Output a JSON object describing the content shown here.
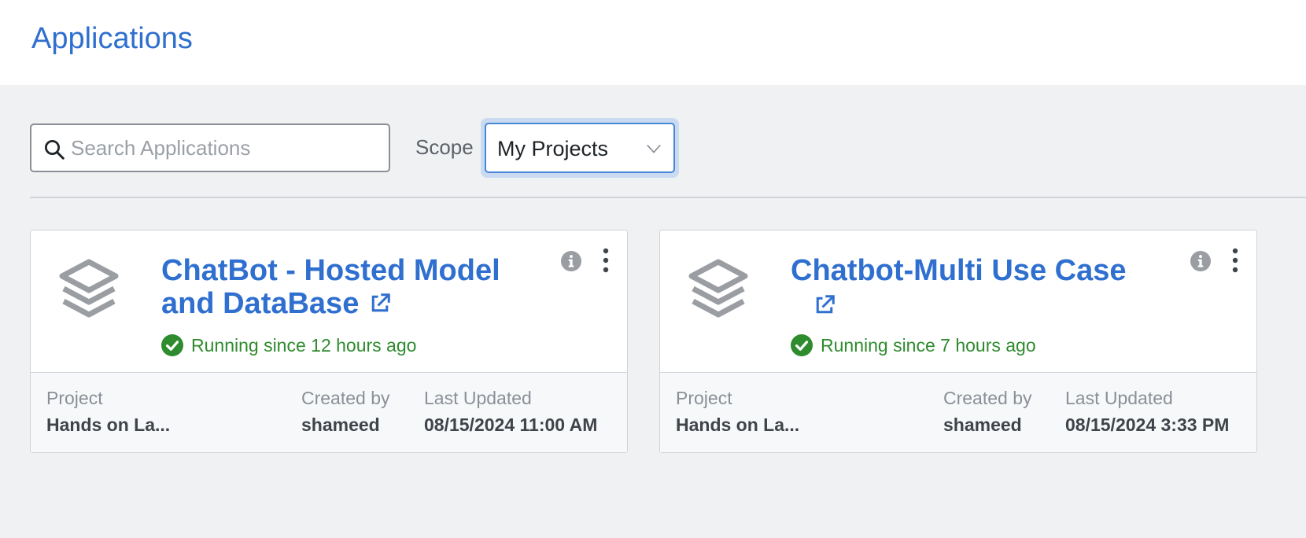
{
  "header": {
    "title": "Applications"
  },
  "toolbar": {
    "search_placeholder": "Search Applications",
    "search_value": "",
    "scope_label": "Scope",
    "scope_value": "My Projects"
  },
  "labels": {
    "project": "Project",
    "created_by": "Created by",
    "last_updated": "Last Updated"
  },
  "applications": [
    {
      "title": "ChatBot - Hosted Model and DataBase",
      "status": "Running since 12 hours ago",
      "project": "Hands on La...",
      "created_by": "shameed",
      "last_updated": "08/15/2024 11:00 AM"
    },
    {
      "title": "Chatbot-Multi Use Case",
      "status": "Running since 7 hours ago",
      "project": "Hands on La...",
      "created_by": "shameed",
      "last_updated": "08/15/2024 3:33 PM"
    }
  ],
  "colors": {
    "accent": "#2f6fcf",
    "status_running": "#2e8b2e",
    "icon_gray": "#9a9ea3"
  },
  "icons": [
    "search-icon",
    "chevron-down-icon",
    "layers-icon",
    "external-link-icon",
    "info-icon",
    "more-vertical-icon",
    "check-circle-icon"
  ]
}
